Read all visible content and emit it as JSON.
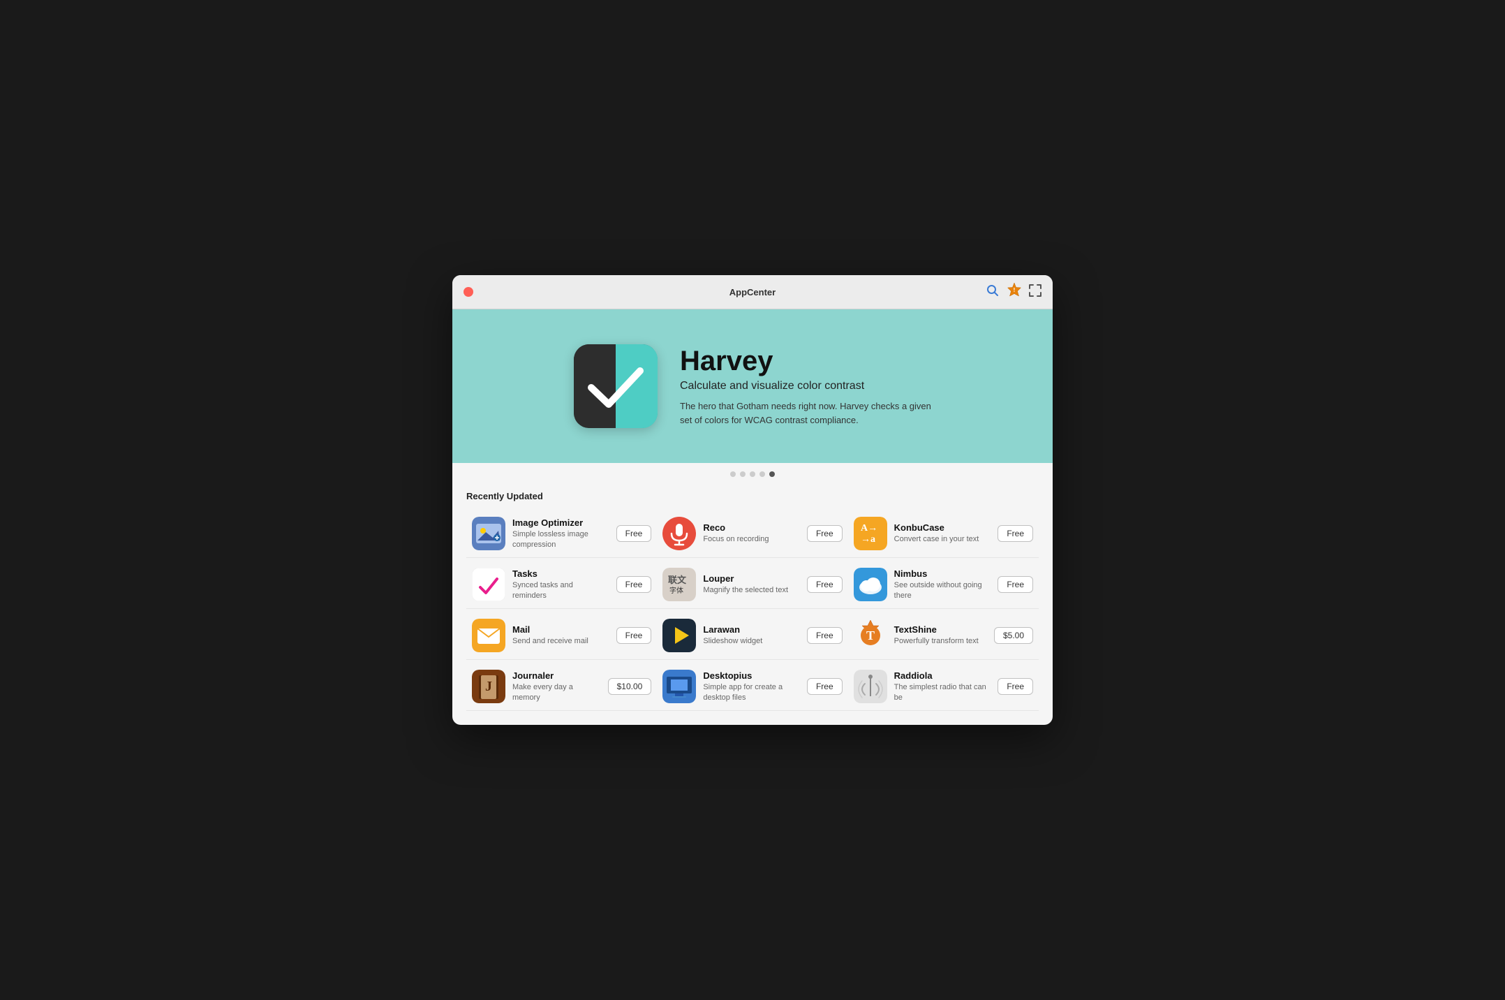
{
  "window": {
    "title": "AppCenter"
  },
  "hero": {
    "app_name": "Harvey",
    "tagline": "Calculate and visualize color contrast",
    "description": "The hero that Gotham needs right now. Harvey checks a given set of colors for WCAG contrast compliance."
  },
  "carousel": {
    "dots": [
      false,
      false,
      false,
      false,
      true
    ]
  },
  "section": {
    "title": "Recently Updated"
  },
  "apps": [
    {
      "name": "Image Optimizer",
      "description": "Simple lossless image compression",
      "price": "Free",
      "icon_type": "image-optimizer"
    },
    {
      "name": "Reco",
      "description": "Focus on recording",
      "price": "Free",
      "icon_type": "reco"
    },
    {
      "name": "KonbuCase",
      "description": "Convert case in your text",
      "price": "Free",
      "icon_type": "konbucase"
    },
    {
      "name": "Tasks",
      "description": "Synced tasks and reminders",
      "price": "Free",
      "icon_type": "tasks"
    },
    {
      "name": "Louper",
      "description": "Magnify the selected text",
      "price": "Free",
      "icon_type": "louper"
    },
    {
      "name": "Nimbus",
      "description": "See outside without going there",
      "price": "Free",
      "icon_type": "nimbus"
    },
    {
      "name": "Mail",
      "description": "Send and receive mail",
      "price": "Free",
      "icon_type": "mail"
    },
    {
      "name": "Larawan",
      "description": "Slideshow widget",
      "price": "Free",
      "icon_type": "larawan"
    },
    {
      "name": "TextShine",
      "description": "Powerfully transform text",
      "price": "$5.00",
      "icon_type": "textshine"
    },
    {
      "name": "Journaler",
      "description": "Make every day a memory",
      "price": "$10.00",
      "icon_type": "journaler"
    },
    {
      "name": "Desktopius",
      "description": "Simple app for create a desktop files",
      "price": "Free",
      "icon_type": "desktopius"
    },
    {
      "name": "Raddiola",
      "description": "The simplest radio that can be",
      "price": "Free",
      "icon_type": "raddiola"
    }
  ],
  "buttons": {
    "close": "×",
    "search_title": "Search",
    "badge_title": "Updates",
    "expand_title": "Expand"
  }
}
